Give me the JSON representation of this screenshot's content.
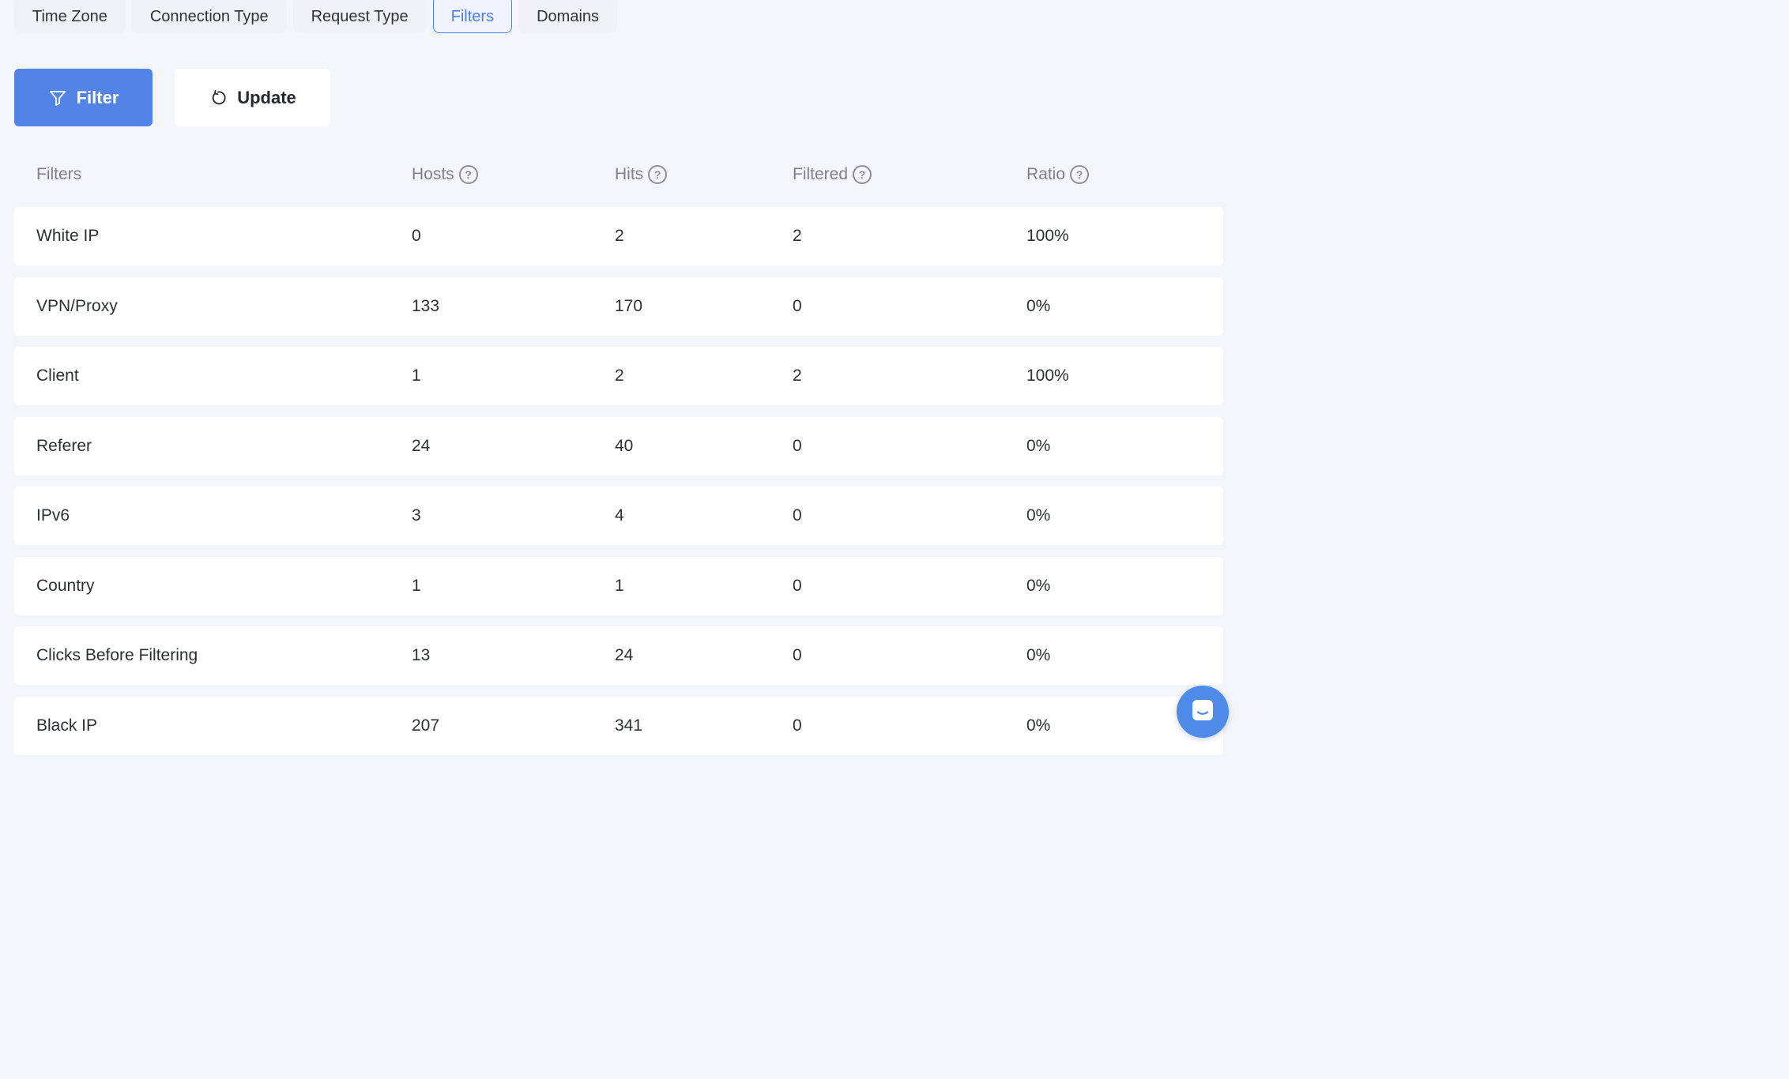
{
  "tabs": [
    {
      "label": "Time Zone",
      "active": false
    },
    {
      "label": "Connection Type",
      "active": false
    },
    {
      "label": "Request Type",
      "active": false
    },
    {
      "label": "Filters",
      "active": true
    },
    {
      "label": "Domains",
      "active": false
    }
  ],
  "actions": {
    "filter_label": "Filter",
    "filter_icon": "funnel-icon",
    "update_label": "Update",
    "update_icon": "refresh-icon"
  },
  "table": {
    "columns": [
      "Filters",
      "Hosts",
      "Hits",
      "Filtered",
      "Ratio"
    ],
    "help_icon": "question-circle-icon",
    "rows": [
      [
        "White IP",
        "0",
        "2",
        "2",
        "100%"
      ],
      [
        "VPN/Proxy",
        "133",
        "170",
        "0",
        "0%"
      ],
      [
        "Client",
        "1",
        "2",
        "2",
        "100%"
      ],
      [
        "Referer",
        "24",
        "40",
        "0",
        "0%"
      ],
      [
        "IPv6",
        "3",
        "4",
        "0",
        "0%"
      ],
      [
        "Country",
        "1",
        "1",
        "0",
        "0%"
      ],
      [
        "Clicks Before Filtering",
        "13",
        "24",
        "0",
        "0%"
      ],
      [
        "Black IP",
        "207",
        "341",
        "0",
        "0%"
      ]
    ]
  },
  "colors": {
    "accent": "#5284e8",
    "background": "#f4f5fa",
    "header_text": "#7d818b"
  },
  "chat": {
    "icon": "chat-bubble-icon"
  }
}
